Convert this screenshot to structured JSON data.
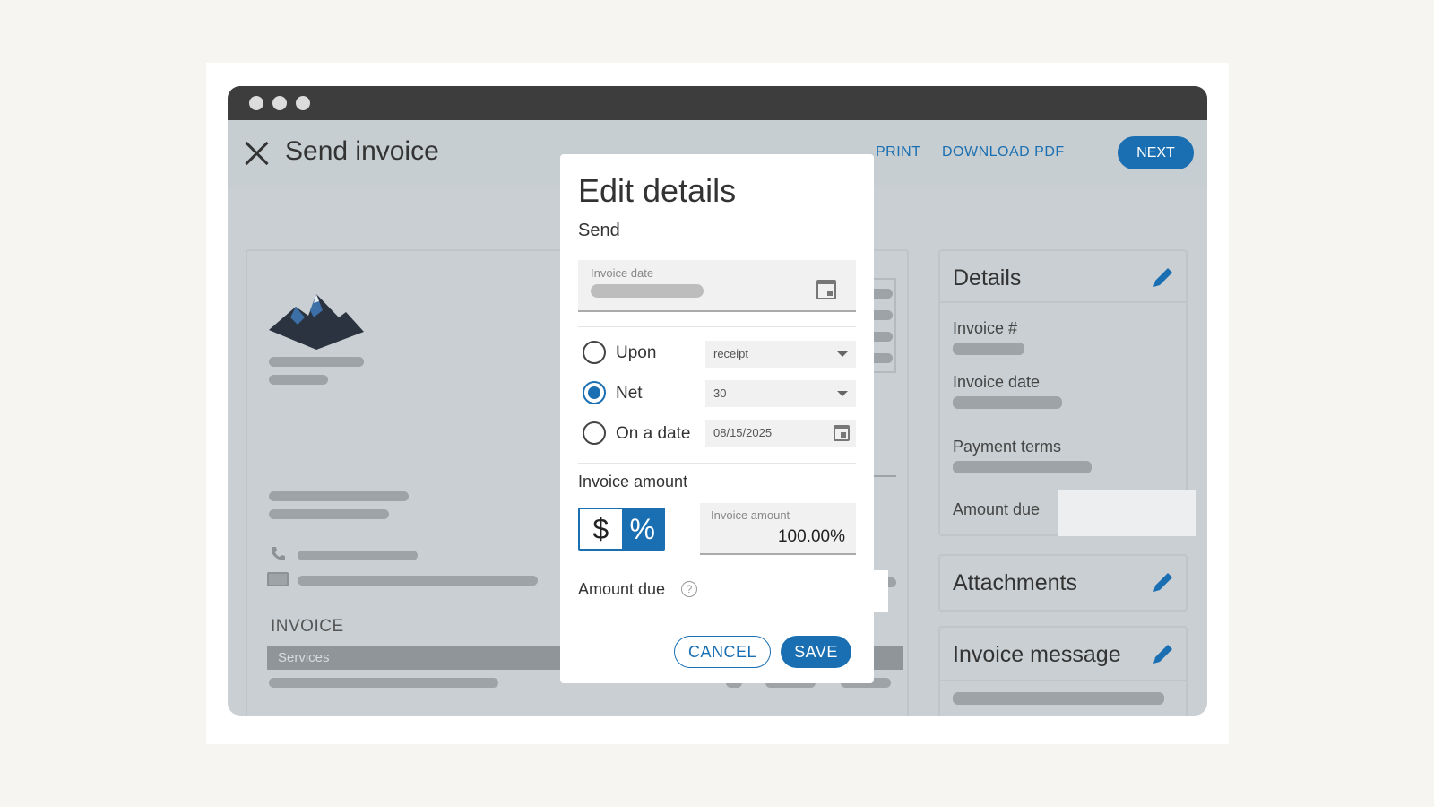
{
  "header": {
    "title": "Send invoice",
    "print_label": "PRINT",
    "download_label": "DOWNLOAD PDF",
    "next_label": "NEXT"
  },
  "document": {
    "invoice_heading": "INVOICE",
    "services_label": "Services"
  },
  "side_panel": {
    "details_title": "Details",
    "invoice_number_label": "Invoice #",
    "invoice_date_label": "Invoice date",
    "payment_terms_label": "Payment terms",
    "amount_due_label": "Amount due",
    "attachments_title": "Attachments",
    "invoice_message_title": "Invoice message"
  },
  "modal": {
    "title": "Edit details",
    "subtitle": "Send",
    "invoice_date_label": "Invoice date",
    "terms": [
      {
        "label": "Upon",
        "value": "receipt",
        "checked": false
      },
      {
        "label": "Net",
        "value": "30",
        "checked": true
      },
      {
        "label": "On a date",
        "value": "08/15/2025",
        "checked": false
      }
    ],
    "invoice_amount_label": "Invoice amount",
    "amount_toggle": {
      "dollar": "$",
      "percent": "%",
      "selected": "percent"
    },
    "amount_field_label": "Invoice amount",
    "amount_field_value": "100.00%",
    "amount_due_label": "Amount due",
    "help_glyph": "?",
    "cancel_label": "CANCEL",
    "save_label": "SAVE"
  },
  "colors": {
    "accent": "#1a6fb2",
    "titlebar": "#3d3d3d",
    "window_bg": "#c9cfd2"
  }
}
